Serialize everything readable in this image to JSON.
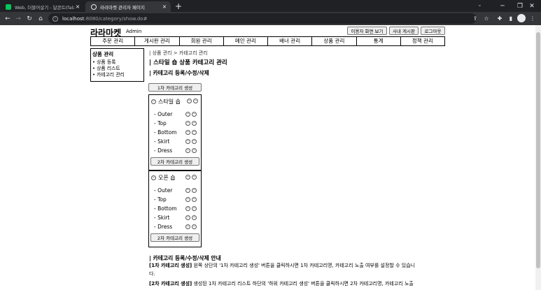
{
  "browser": {
    "tabs": [
      {
        "title": "Web, 더블어살기 - 달콘트(falam"
      },
      {
        "title": "라라마켓 관리자 페이지"
      }
    ],
    "url_host": "localhost",
    "url_path": ":8080/category/show.do#"
  },
  "header": {
    "logo": "라라마켓",
    "admin_label": "Admin",
    "buttons": [
      "이용자 화면 보기",
      "사내 게시판",
      "로그아웃"
    ]
  },
  "menu": [
    "주문 관리",
    "게시판 관리",
    "회원 관리",
    "메인 관리",
    "배너 관리",
    "상품 관리",
    "통계",
    "정책 관리"
  ],
  "sidebar": {
    "title": "상품 관리",
    "items": [
      "상품 등록",
      "상품 리스트",
      "카테고리 관리"
    ]
  },
  "breadcrumb": "| 상품 관리 > 카테고리 관리",
  "page_title": "| 스타일 숍 상품 카테고리 관리",
  "section_title": "| 카테고리 등록/수정/삭제",
  "create_first_button": "1차 카테고리 생성",
  "categories": [
    {
      "name": "스타일 숍",
      "subs": [
        "- Outer",
        "- Top",
        "- Bottom",
        "- Skirt",
        "- Dress"
      ],
      "add_sub_button": "2차 카테고리 생성"
    },
    {
      "name": "오픈 숍",
      "subs": [
        "- Outer",
        "- Top",
        "- Bottom",
        "- Skirt",
        "- Dress"
      ],
      "add_sub_button": "2차 카테고리 생성"
    }
  ],
  "guide": {
    "title": "| 카테고리 등록/수정/삭제 안내",
    "lines": [
      {
        "bold": "[1차 카테고리 생성]",
        "text": " 왼쪽 상단의 '1차 카테고리 생성' 버튼을 클릭하시면 1차 카테고리명, 카테고리 노출 여부를 설정할 수 있습니"
      },
      {
        "bold": "",
        "text": "다."
      },
      {
        "bold": "[2차 카테고리 생성]",
        "text": " 생성된 1차 카테고리 리스트 하단의 '하위 카테고리 생성' 버튼을 클릭하시면 2차 카테고리명, 카테고리 노출"
      }
    ]
  },
  "icons": {
    "toggle": "minus-circle-icon",
    "edit": "edit-circle-icon",
    "delete": "delete-circle-icon"
  }
}
